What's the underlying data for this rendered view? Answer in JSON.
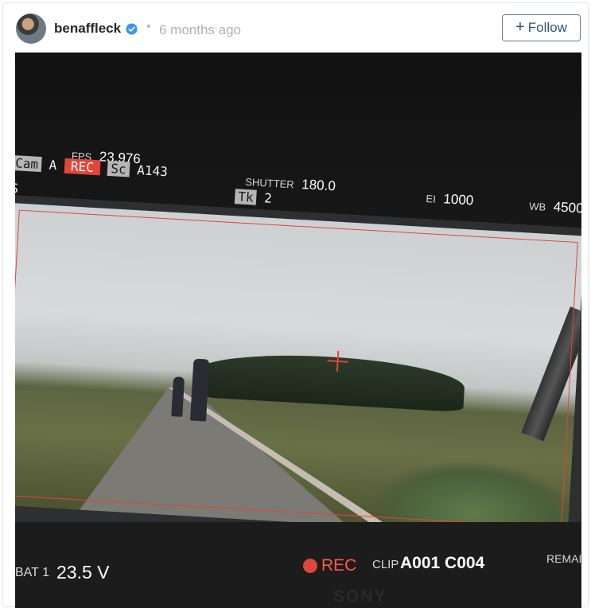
{
  "post": {
    "username": "benaffleck",
    "separator": "•",
    "time_ago": "6 months ago",
    "follow_plus": "+",
    "follow_label": "Follow"
  },
  "overlay": {
    "cam_label": "Cam",
    "cam_value": "A",
    "rec_tag": "REC",
    "sc_label": "Sc",
    "sc_value": "A143",
    "fps_label": "FPS",
    "fps_value": "23.976",
    "shutter_label": "SHUTTER",
    "shutter_value": "180.0",
    "tk_label": "Tk",
    "tk_value": "2",
    "ei_label": "EI",
    "ei_value": "1000",
    "wb_label": "WB",
    "wb_value": "4500",
    "side_s": "S",
    "bat_label": "BAT 1",
    "bat_value": "23.5 V",
    "rec_label": "REC",
    "clip_label": "CLIP",
    "clip_value": "A001 C004",
    "remain_label": "REMAIN",
    "brand": "SONY"
  },
  "colors": {
    "accent_red": "#e0463a",
    "verified_blue": "#3897f0",
    "follow_border": "#5b7e9c"
  }
}
